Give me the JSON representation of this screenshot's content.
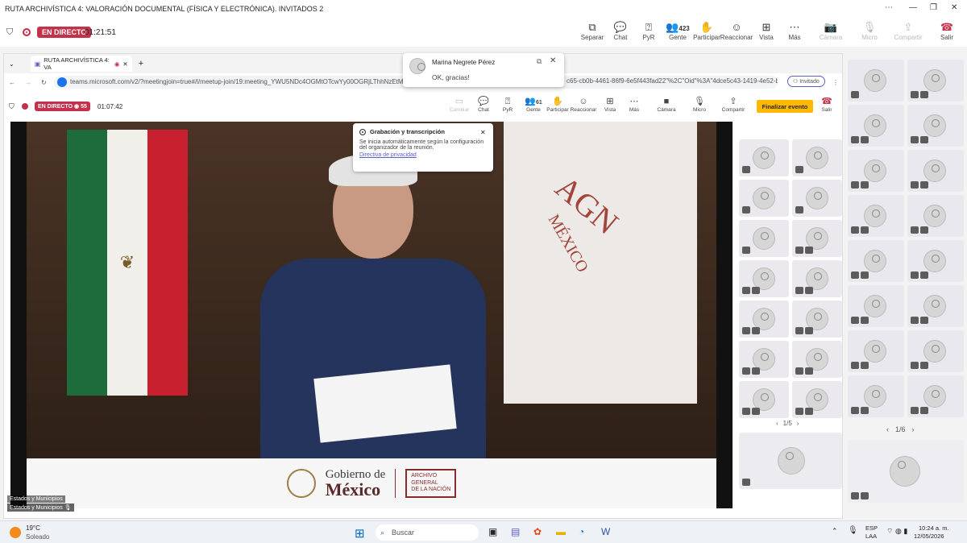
{
  "window": {
    "title": "RUTA ARCHIVÍSTICA 4: VALORACIÓN DOCUMENTAL (FÍSICA Y ELECTRÓNICA). INVITADOS 2"
  },
  "outer_toolbar": {
    "live_label": "EN DIRECTO",
    "elapsed": "01:21:51",
    "buttons": [
      {
        "label": "Separar",
        "icon": "pop-out-icon"
      },
      {
        "label": "Chat",
        "icon": "chat-icon"
      },
      {
        "label": "PyR",
        "icon": "qa-icon"
      },
      {
        "label": "Gente",
        "icon": "people-icon",
        "count": "423"
      },
      {
        "label": "Participar",
        "icon": "hand-icon"
      },
      {
        "label": "Reaccionar",
        "icon": "smile-icon"
      },
      {
        "label": "Vista",
        "icon": "grid-icon"
      },
      {
        "label": "Más",
        "icon": "more-icon"
      },
      {
        "label": "Cámara",
        "icon": "camera-off-icon"
      },
      {
        "label": "Micro",
        "icon": "mic-off-icon"
      },
      {
        "label": "Compartir",
        "icon": "share-icon"
      },
      {
        "label": "Salir",
        "icon": "hangup-icon"
      }
    ]
  },
  "browser": {
    "tab_title": "RUTA ARCHIVÍSTICA 4: VA",
    "url": "teams.microsoft.com/v2/?meetingjoin=true#/l/meetup-join/19:meeting_YWU5NDc4OGMtOTcwYy00OGRjLThhNzEtMDI5ND",
    "url_tail": "c65-cb0b-4461-86f9-6e5f443fad22\"%2C\"Oid\"%3A\"4dce5c43-1419-4e52-b0...",
    "profile": "Invitado"
  },
  "inner_toolbar": {
    "live_label": "EN DIRECTO",
    "viewers": "55",
    "elapsed": "01:07:42",
    "people_count": "61",
    "buttons": [
      "Cambiar",
      "Chat",
      "PyR",
      "Gente",
      "Participar",
      "Reaccionar",
      "Vista",
      "Más",
      "Cámara",
      "Micro",
      "Compartir"
    ],
    "end_event": "Finalizar evento",
    "leave": "Salir"
  },
  "toast": {
    "name": "Marina Negrete Pérez",
    "message": "OK, gracias!"
  },
  "recording": {
    "title": "Grabación y transcripción",
    "body": "Se inicia automáticamente según la configuración del organizador de la reunión.",
    "link": "Directiva de privacidad"
  },
  "video": {
    "banner_left": "Gobierno de",
    "banner_left2": "México",
    "banner_right1": "ARCHIVO",
    "banner_right2": "GENERAL",
    "banner_right3": "DE LA NACIÓN",
    "flag_text": "AGN",
    "flag_text2": "MÉXICO",
    "caption": "Estados y Municipios",
    "caption2": "Estados y Municipios"
  },
  "inner_gallery": {
    "pager": "1/5"
  },
  "outer_gallery": {
    "pager": "1/6"
  },
  "taskbar": {
    "temp": "19°C",
    "weather": "Soleado",
    "search": "Buscar",
    "lang1": "ESP",
    "lang2": "LAA",
    "time": "10:24 a. m.",
    "date": "12/05/2026"
  },
  "colors": {
    "live": "#c4314b",
    "accent": "#ffb900",
    "teams": "#5b5fc7"
  }
}
